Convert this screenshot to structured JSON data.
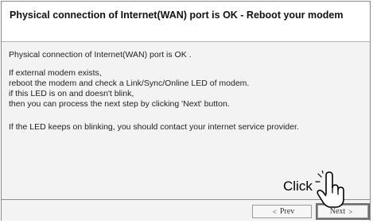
{
  "header": {
    "title": "Physical connection of Internet(WAN) port is OK - Reboot your modem"
  },
  "content": {
    "status": "Physical connection of Internet(WAN) port is OK .",
    "instructions": [
      "If external modem exists,",
      "reboot the modem and check a Link/Sync/Online LED of modem.",
      "if this LED is on and doesn't blink,",
      "then you can process the next step by clicking 'Next' button."
    ],
    "isp_note": "If the LED keeps on blinking, you should contact your internet service provider."
  },
  "footer": {
    "prev_label": "Prev",
    "prev_arrow": "<",
    "next_label": "Next",
    "next_arrow": ">"
  },
  "callout": {
    "text": "Click",
    "icon": "pointing-hand-icon"
  }
}
